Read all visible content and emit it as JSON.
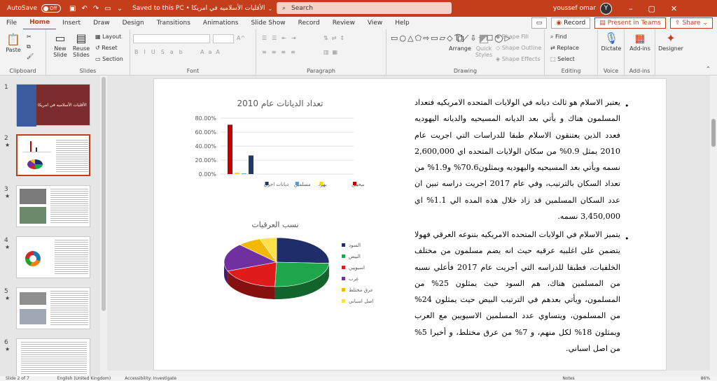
{
  "window": {
    "autosave_label": "AutoSave",
    "autosave_state": "Off",
    "title": "الأقليات الأسلاميه في امريكا • Saved to this PC",
    "search_placeholder": "Search",
    "user_name": "youssef omar",
    "user_initial": "Y"
  },
  "menu": {
    "items": [
      "File",
      "Home",
      "Insert",
      "Draw",
      "Design",
      "Transitions",
      "Animations",
      "Slide Show",
      "Record",
      "Review",
      "View",
      "Help"
    ],
    "record_button": "Record",
    "present_button": "Present in Teams",
    "share_button": "Share"
  },
  "ribbon": {
    "clipboard": {
      "label": "Clipboard",
      "paste": "Paste"
    },
    "slides": {
      "label": "Slides",
      "new_slide_1": "New",
      "new_slide_2": "Slide",
      "reuse_1": "Reuse",
      "reuse_2": "Slides",
      "layout": "Layout",
      "reset": "Reset",
      "section": "Section"
    },
    "font": {
      "label": "Font"
    },
    "paragraph": {
      "label": "Paragraph"
    },
    "drawing": {
      "label": "Drawing",
      "arrange": "Arrange",
      "quick_styles_1": "Quick",
      "quick_styles_2": "Styles",
      "shape_fill": "Shape Fill",
      "shape_outline": "Shape Outline",
      "shape_effects": "Shape Effects"
    },
    "editing": {
      "label": "Editing",
      "find": "Find",
      "replace": "Replace",
      "select": "Select"
    },
    "voice": {
      "label": "Voice",
      "dictate": "Dictate"
    },
    "addins": {
      "label": "Add-ins",
      "addins_button": "Add-ins"
    },
    "designer": {
      "designer_button": "Designer"
    }
  },
  "thumbnails": {
    "numbers": [
      "1",
      "2",
      "3",
      "4",
      "5",
      "6"
    ],
    "star": "★",
    "slide1_caption": "الأقليات الأسلاميه في امريكا"
  },
  "slide": {
    "paragraph1": "يعتبر الاسلام هو ثالث ديانه في الولايات المتحده الامريكيه فتعداد المسلمون هناك و يأتي بعد الديانه المسيحيه والديانه اليهوديه فعدد الذين يعتنقون الاسلام طبقا للدراسات التي اجريت عام 2010 يمثل 0.9% من سكان الولايات المتحده اي 2,600,000 نسمه ويأتي بعد المسيحيه واليهوديه ويمثلون70.6% و1.9% من تعداد السكان بالترتيب، وفي عام 2017 اجريت دراسه تبين ان عدد السكان المسلمين قد زاد خلال هذه المده الي 1.1% اي 3,450,000 نسمه.",
    "paragraph2": "يتميز الاسلام في الولايات المتحده الامريكيه بتنوعه العرقي فهولا يتضمن علي اغلبيه عرقيه حيث انه يضم مسلمون من مختلف الخلفيات، فطبقا للدراسه التي أجريت عام  2017 فأعلي نسبه من المسلمين هناك، هم السود حيث يمثلون 25% من المسلمون، ويأتي بعدهم في الترتيب البيض حيث يمثلون 24% من المسلمون، ويتساوي عدد المسلمين الاسيويين مع العرب ويمثلون 18% لكل منهم، و 7% من عرق مختلط، و أخيرا 5% من اصل اسباني.",
    "bullet": "•"
  },
  "chart_data": [
    {
      "type": "bar",
      "title": "تعداد الديانات عام 2010",
      "categories": [
        ""
      ],
      "series": [
        {
          "name": "مسيحيين",
          "values": [
            70.6
          ],
          "color": "#c00000"
        },
        {
          "name": "يهود",
          "values": [
            1.9
          ],
          "color": "#ffd700"
        },
        {
          "name": "مسلمين",
          "values": [
            0.9
          ],
          "color": "#5b9bd5"
        },
        {
          "name": "ديانات اخري",
          "values": [
            26.6
          ],
          "color": "#1f3864"
        }
      ],
      "ylim": [
        0,
        80
      ],
      "yticks": [
        "0.00%",
        "20.00%",
        "40.00%",
        "60.00%",
        "80.00%"
      ],
      "grid": true,
      "legend": "bottom"
    },
    {
      "type": "pie",
      "title": "نسب العرقيات",
      "labels": [
        "السود",
        "البيض",
        "اسيويين",
        "عرب",
        "عرق مختلط",
        "اصل اسباني"
      ],
      "values": [
        25,
        24,
        18,
        18,
        7,
        5
      ],
      "colors": [
        "#1f2d6b",
        "#1ea64a",
        "#e01b1b",
        "#7030a0",
        "#f5b800",
        "#ffe04a"
      ],
      "legend": "right"
    }
  ],
  "status": {
    "slide_of": "Slide 2 of 7",
    "language": "English (United Kingdom)",
    "accessibility": "Accessibility: Investigate",
    "notes": "Notes",
    "zoom": "86%"
  }
}
